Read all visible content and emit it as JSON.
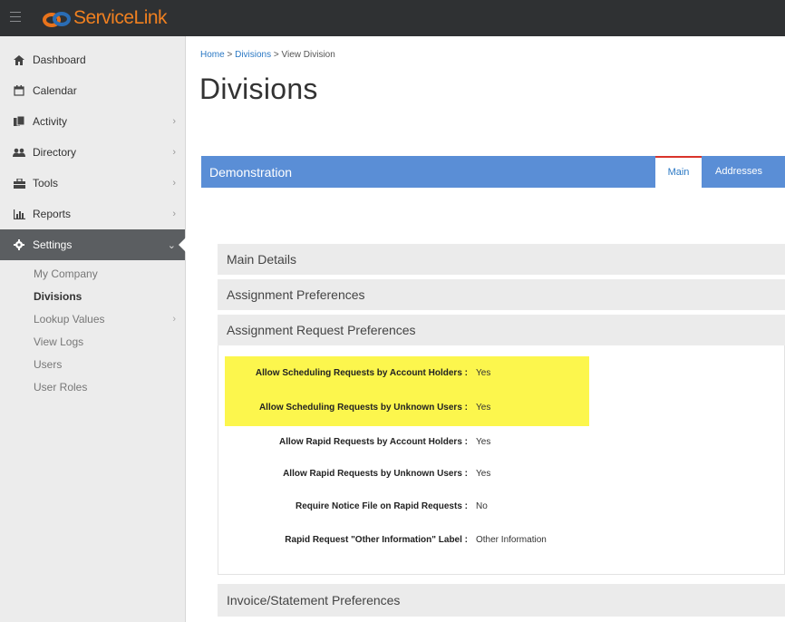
{
  "app": {
    "logo_text": "ServiceLink"
  },
  "sidebar": {
    "items": [
      {
        "label": "Dashboard",
        "icon": "home-icon"
      },
      {
        "label": "Calendar",
        "icon": "calendar-icon"
      },
      {
        "label": "Activity",
        "icon": "activity-icon"
      },
      {
        "label": "Directory",
        "icon": "users-icon"
      },
      {
        "label": "Tools",
        "icon": "toolbox-icon"
      },
      {
        "label": "Reports",
        "icon": "bar-chart-icon"
      },
      {
        "label": "Settings",
        "icon": "gear-icon"
      }
    ],
    "settings_sub": [
      {
        "label": "My Company"
      },
      {
        "label": "Divisions"
      },
      {
        "label": "Lookup Values"
      },
      {
        "label": "View Logs"
      },
      {
        "label": "Users"
      },
      {
        "label": "User Roles"
      }
    ]
  },
  "breadcrumb": {
    "home": "Home",
    "sep1": " > ",
    "divisions": "Divisions",
    "sep2": " > ",
    "current": "View Division"
  },
  "page": {
    "title": "Divisions"
  },
  "panel": {
    "title": "Demonstration",
    "tabs": [
      {
        "label": "Main"
      },
      {
        "label": "Addresses"
      }
    ]
  },
  "sections": {
    "main_details": "Main Details",
    "assignment_preferences": "Assignment Preferences",
    "assignment_request_preferences": "Assignment Request Preferences",
    "invoice_statement_preferences": "Invoice/Statement Preferences"
  },
  "request_prefs": [
    {
      "label": "Allow Scheduling Requests by Account Holders :",
      "value": "Yes"
    },
    {
      "label": "Allow Scheduling Requests by Unknown Users :",
      "value": "Yes"
    },
    {
      "label": "Allow Rapid Requests by Account Holders :",
      "value": "Yes"
    },
    {
      "label": "Allow Rapid Requests by Unknown Users :",
      "value": "Yes"
    },
    {
      "label": "Require Notice File on Rapid Requests :",
      "value": "No"
    },
    {
      "label": "Rapid Request \"Other Information\" Label :",
      "value": "Other Information"
    }
  ],
  "colors": {
    "topbar": "#2f3133",
    "brand_orange": "#f08020",
    "panel_blue": "#5a8ed6",
    "highlight_yellow": "#fcf64d",
    "active_tab_border": "#d9342b"
  }
}
